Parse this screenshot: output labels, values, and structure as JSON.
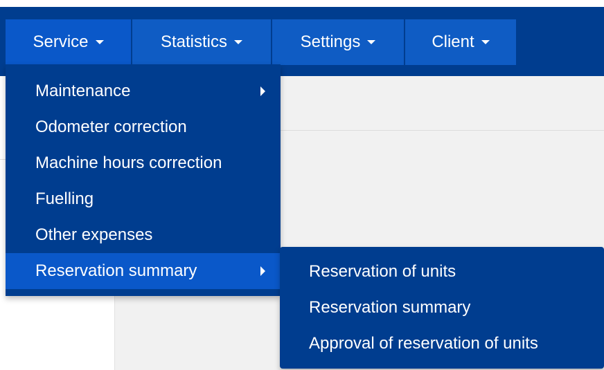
{
  "navbar": {
    "items": [
      {
        "label": "Service"
      },
      {
        "label": "Statistics"
      },
      {
        "label": "Settings"
      },
      {
        "label": "Client"
      }
    ]
  },
  "service_menu": {
    "items": [
      {
        "label": "Maintenance",
        "has_submenu": true
      },
      {
        "label": "Odometer correction",
        "has_submenu": false
      },
      {
        "label": "Machine hours correction",
        "has_submenu": false
      },
      {
        "label": "Fuelling",
        "has_submenu": false
      },
      {
        "label": "Other expenses",
        "has_submenu": false
      },
      {
        "label": "Reservation summary",
        "has_submenu": true
      }
    ]
  },
  "reservation_submenu": {
    "items": [
      {
        "label": "Reservation of units"
      },
      {
        "label": "Reservation summary"
      },
      {
        "label": "Approval of reservation of units"
      }
    ]
  },
  "colors": {
    "navbar_bg": "#003d8f",
    "nav_item_bg": "#0f5cc4",
    "active_item_bg": "#0a58c9",
    "page_bg": "#f1f1f1"
  }
}
